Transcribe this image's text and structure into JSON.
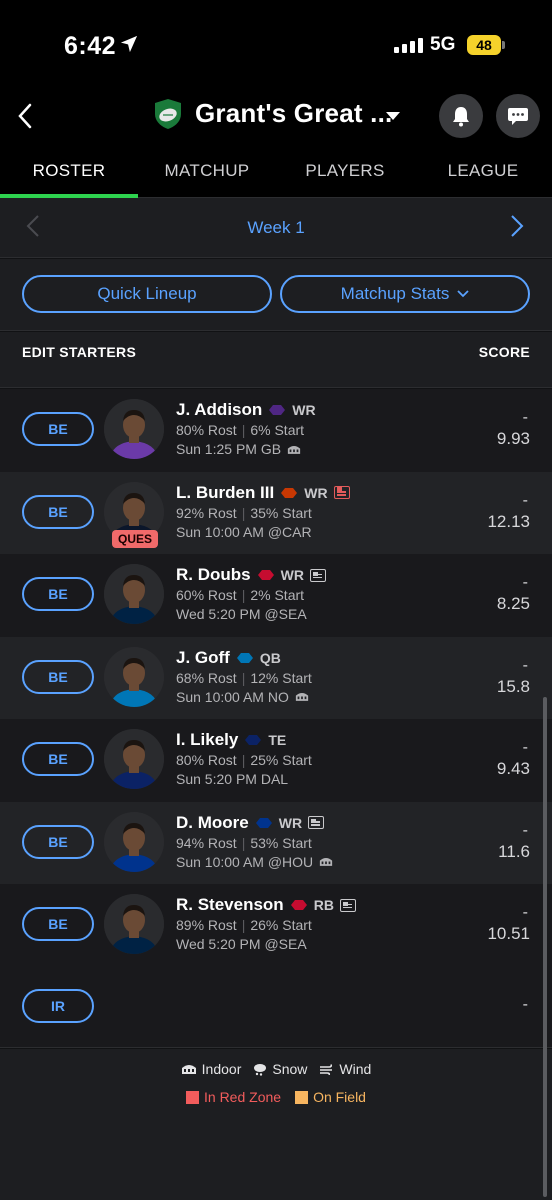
{
  "status": {
    "time": "6:42",
    "network": "5G",
    "battery": "48"
  },
  "header": {
    "league_name": "Grant's Great ...",
    "icons": [
      "back-icon",
      "league-logo",
      "chevron-down-icon",
      "bell-icon",
      "chat-icon"
    ]
  },
  "tabs": [
    "ROSTER",
    "MATCHUP",
    "PLAYERS",
    "LEAGUE"
  ],
  "active_tab": "ROSTER",
  "week": {
    "label": "Week 1"
  },
  "actions": {
    "quick_lineup": "Quick Lineup",
    "matchup_stats": "Matchup Stats"
  },
  "starters_header": {
    "left": "EDIT STARTERS",
    "right": "SCORE"
  },
  "players": [
    {
      "slot": "BE",
      "name": "J. Addison",
      "pos": "WR",
      "rost": "80% Rost",
      "start": "6% Start",
      "game": "Sun 1:25 PM GB",
      "dash": "-",
      "score": "9.93",
      "team_color": "#4f2683",
      "jersey": "#6b3aa8",
      "status": "",
      "news": "",
      "indoor": true
    },
    {
      "slot": "BE",
      "name": "L. Burden III",
      "pos": "WR",
      "rost": "92% Rost",
      "start": "35% Start",
      "game": "Sun 10:00 AM @CAR",
      "dash": "-",
      "score": "12.13",
      "team_color": "#c83803",
      "jersey": "#0b162a",
      "status": "QUES",
      "news": "red",
      "indoor": false
    },
    {
      "slot": "BE",
      "name": "R. Doubs",
      "pos": "WR",
      "rost": "60% Rost",
      "start": "2% Start",
      "game": "Wed 5:20 PM @SEA",
      "dash": "-",
      "score": "8.25",
      "team_color": "#c60c30",
      "jersey": "#002244",
      "status": "",
      "news": "gray",
      "indoor": false
    },
    {
      "slot": "BE",
      "name": "J. Goff",
      "pos": "QB",
      "rost": "68% Rost",
      "start": "12% Start",
      "game": "Sun 10:00 AM NO",
      "dash": "-",
      "score": "15.8",
      "team_color": "#0076b6",
      "jersey": "#0076b6",
      "status": "",
      "news": "",
      "indoor": true
    },
    {
      "slot": "BE",
      "name": "I. Likely",
      "pos": "TE",
      "rost": "80% Rost",
      "start": "25% Start",
      "game": "Sun 5:20 PM DAL",
      "dash": "-",
      "score": "9.43",
      "team_color": "#0b2265",
      "jersey": "#0b2265",
      "status": "",
      "news": "",
      "indoor": false
    },
    {
      "slot": "BE",
      "name": "D. Moore",
      "pos": "WR",
      "rost": "94% Rost",
      "start": "53% Start",
      "game": "Sun 10:00 AM @HOU",
      "dash": "-",
      "score": "11.6",
      "team_color": "#00338d",
      "jersey": "#00338d",
      "status": "",
      "news": "gray",
      "indoor": true
    },
    {
      "slot": "BE",
      "name": "R. Stevenson",
      "pos": "RB",
      "rost": "89% Rost",
      "start": "26% Start",
      "game": "Wed 5:20 PM @SEA",
      "dash": "-",
      "score": "10.51",
      "team_color": "#c60c30",
      "jersey": "#002244",
      "status": "",
      "news": "gray",
      "indoor": false
    }
  ],
  "ir": {
    "slot": "IR",
    "dash": "-"
  },
  "legend": {
    "indoor": "Indoor",
    "snow": "Snow",
    "wind": "Wind",
    "red_zone": "In Red Zone",
    "on_field": "On Field",
    "red_zone_color": "#f25c5c",
    "on_field_color": "#f7b560"
  }
}
